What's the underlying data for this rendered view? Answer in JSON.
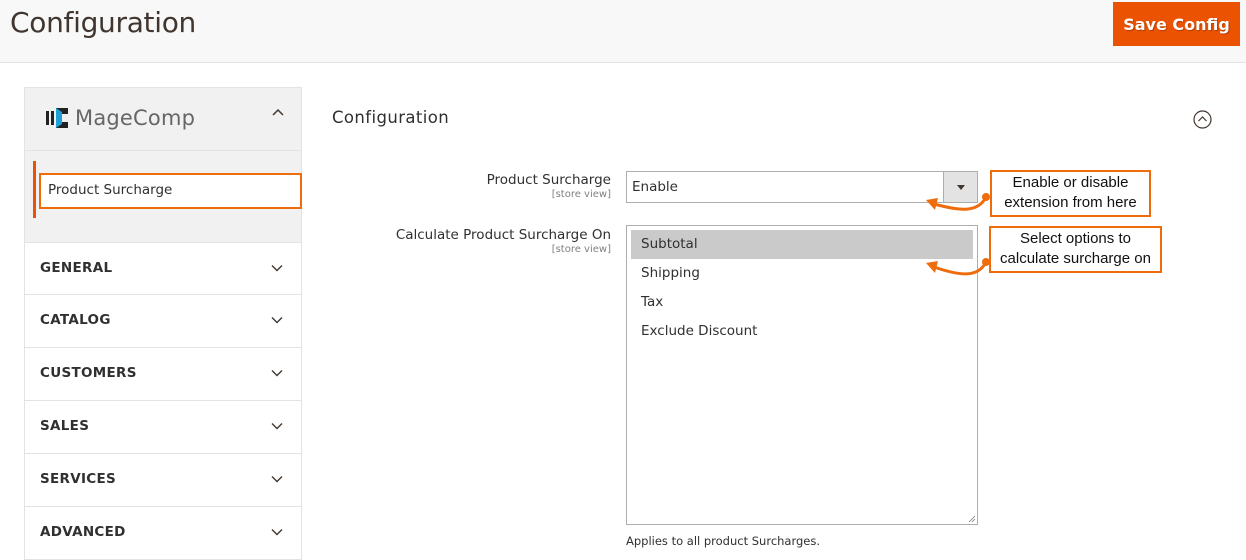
{
  "header": {
    "title": "Configuration",
    "save_label": "Save Config"
  },
  "sidebar": {
    "brand": "MageComp",
    "sub_items": [
      {
        "label": "Product Surcharge",
        "active": true
      }
    ],
    "sections": [
      {
        "label": "GENERAL"
      },
      {
        "label": "CATALOG"
      },
      {
        "label": "CUSTOMERS"
      },
      {
        "label": "SALES"
      },
      {
        "label": "SERVICES"
      },
      {
        "label": "ADVANCED"
      }
    ]
  },
  "main": {
    "section_title": "Configuration",
    "fields": {
      "product_surcharge": {
        "label": "Product Surcharge",
        "scope": "[store view]",
        "value": "Enable"
      },
      "calculate_on": {
        "label": "Calculate Product Surcharge On",
        "scope": "[store view]",
        "options": [
          {
            "label": "Subtotal",
            "selected": true
          },
          {
            "label": "Shipping",
            "selected": false
          },
          {
            "label": "Tax",
            "selected": false
          },
          {
            "label": "Exclude Discount",
            "selected": false
          }
        ],
        "note": "Applies to all product Surcharges."
      }
    }
  },
  "annotations": {
    "callout_1_line1": "Enable or disable",
    "callout_1_line2": "extension from here",
    "callout_2_line1": "Select options to",
    "callout_2_line2": "calculate surcharge on",
    "accent": "#ef6c0c"
  },
  "colors": {
    "primary_button": "#eb5202",
    "active_marker": "#eb5202"
  }
}
